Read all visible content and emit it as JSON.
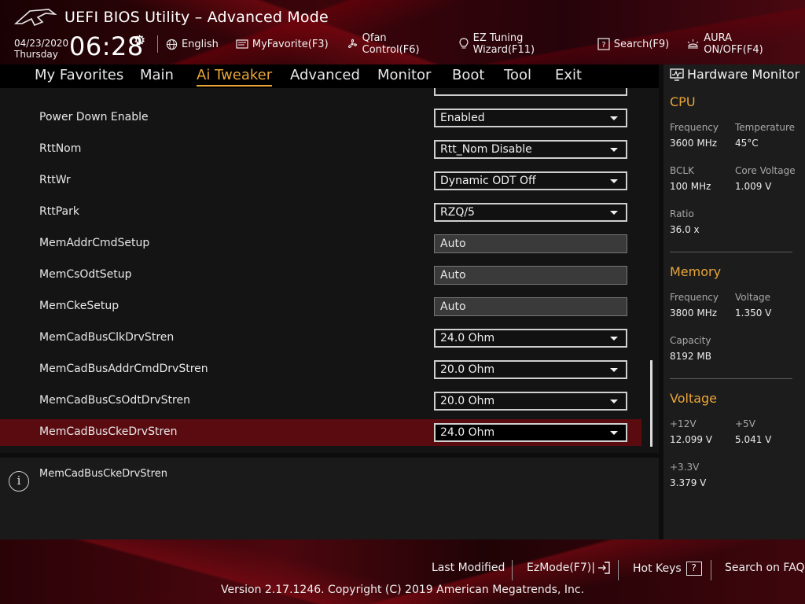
{
  "header": {
    "title": "UEFI BIOS Utility – Advanced Mode",
    "date": "04/23/2020",
    "day": "Thursday",
    "time": "06:28",
    "toolbar": [
      {
        "label": "English",
        "icon": "globe-icon"
      },
      {
        "label": "MyFavorite(F3)",
        "icon": "favorite-icon"
      },
      {
        "label": "Qfan Control(F6)",
        "icon": "fan-icon"
      },
      {
        "label": "EZ Tuning Wizard(F11)",
        "icon": "bulb-icon"
      },
      {
        "label": "Search(F9)",
        "icon": "search-icon"
      },
      {
        "label": "AURA ON/OFF(F4)",
        "icon": "aura-icon"
      }
    ]
  },
  "nav": {
    "tabs": [
      "My Favorites",
      "Main",
      "Ai Tweaker",
      "Advanced",
      "Monitor",
      "Boot",
      "Tool",
      "Exit"
    ],
    "active": "Ai Tweaker"
  },
  "settings": [
    {
      "label": "Power Down Enable",
      "value": "Enabled",
      "type": "dropdown"
    },
    {
      "label": "RttNom",
      "value": "Rtt_Nom Disable",
      "type": "dropdown"
    },
    {
      "label": "RttWr",
      "value": "Dynamic ODT Off",
      "type": "dropdown"
    },
    {
      "label": "RttPark",
      "value": "RZQ/5",
      "type": "dropdown"
    },
    {
      "label": "MemAddrCmdSetup",
      "value": "Auto",
      "type": "input"
    },
    {
      "label": "MemCsOdtSetup",
      "value": "Auto",
      "type": "input"
    },
    {
      "label": "MemCkeSetup",
      "value": "Auto",
      "type": "input"
    },
    {
      "label": "MemCadBusClkDrvStren",
      "value": "24.0 Ohm",
      "type": "dropdown"
    },
    {
      "label": "MemCadBusAddrCmdDrvStren",
      "value": "20.0 Ohm",
      "type": "dropdown"
    },
    {
      "label": "MemCadBusCsOdtDrvStren",
      "value": "20.0 Ohm",
      "type": "dropdown"
    },
    {
      "label": "MemCadBusCkeDrvStren",
      "value": "24.0 Ohm",
      "type": "dropdown",
      "selected": true
    }
  ],
  "help": {
    "text": "MemCadBusCkeDrvStren"
  },
  "hardware_monitor": {
    "title": "Hardware Monitor",
    "cpu": {
      "title": "CPU",
      "frequency_label": "Frequency",
      "frequency": "3600 MHz",
      "temperature_label": "Temperature",
      "temperature": "45°C",
      "bclk_label": "BCLK",
      "bclk": "100 MHz",
      "core_voltage_label": "Core Voltage",
      "core_voltage": "1.009 V",
      "ratio_label": "Ratio",
      "ratio": "36.0 x"
    },
    "memory": {
      "title": "Memory",
      "frequency_label": "Frequency",
      "frequency": "3800 MHz",
      "voltage_label": "Voltage",
      "voltage": "1.350 V",
      "capacity_label": "Capacity",
      "capacity": "8192 MB"
    },
    "voltage": {
      "title": "Voltage",
      "v12_label": "+12V",
      "v12": "12.099 V",
      "v5_label": "+5V",
      "v5": "5.041 V",
      "v33_label": "+3.3V",
      "v33": "3.379 V"
    }
  },
  "footer": {
    "last_modified": "Last Modified",
    "ezmode": "EzMode(F7)|",
    "hot_keys": "Hot Keys",
    "hot_keys_key": "?",
    "search_faq": "Search on FAQ",
    "version": "Version 2.17.1246. Copyright (C) 2019 American Megatrends, Inc."
  },
  "colors": {
    "accent": "#e8a538",
    "selected_row": "#5a0b10",
    "brand_red": "#4a0810"
  }
}
